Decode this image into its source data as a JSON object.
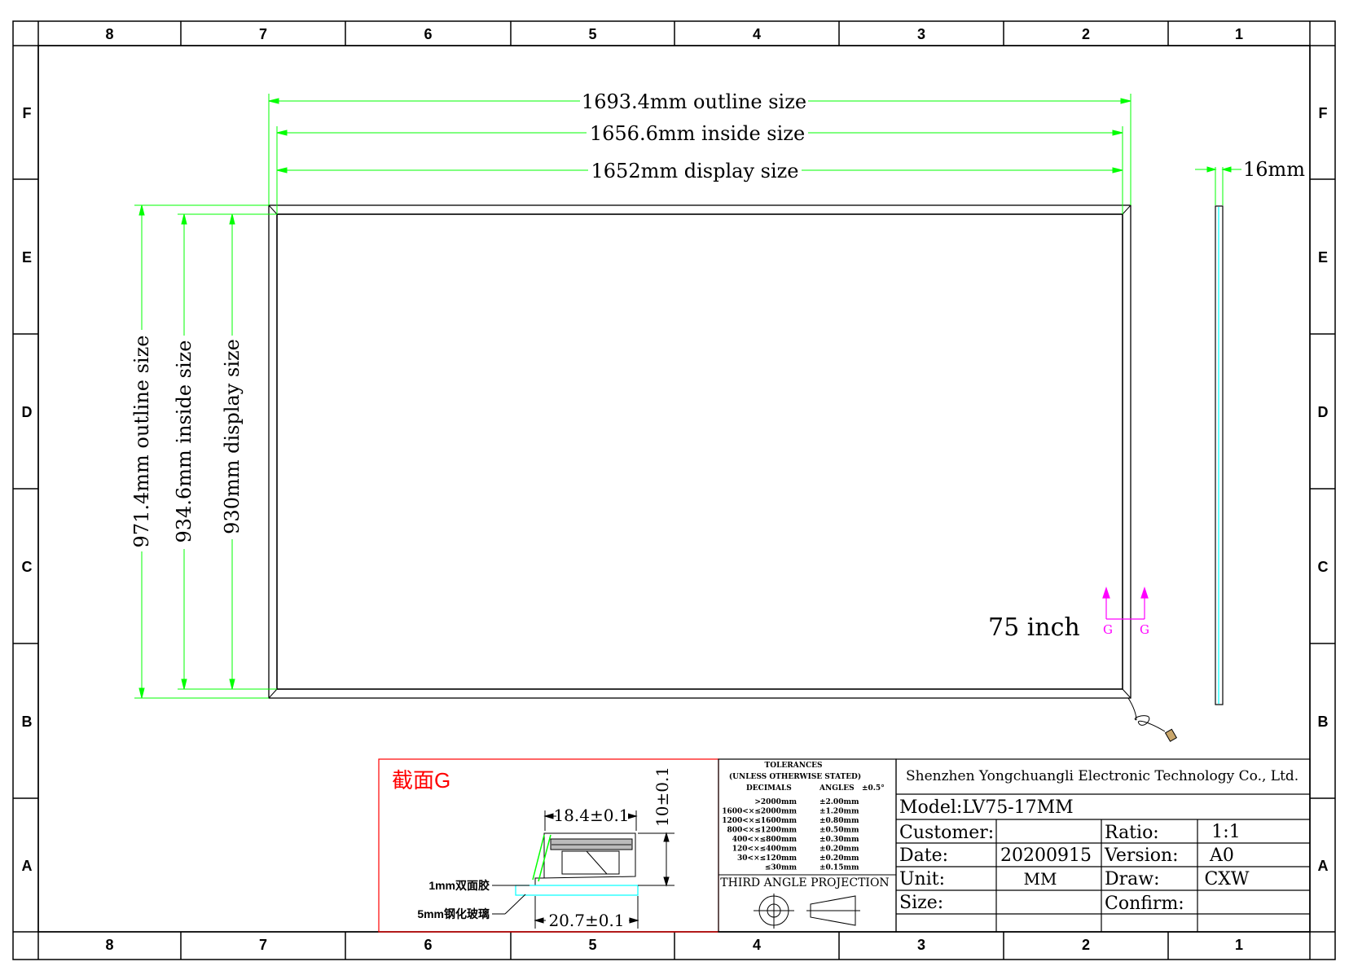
{
  "frame": {
    "columns": [
      "8",
      "7",
      "6",
      "5",
      "4",
      "3",
      "2",
      "1"
    ],
    "rows": [
      "F",
      "E",
      "D",
      "C",
      "B",
      "A"
    ]
  },
  "dimensions": {
    "outline_width": "1693.4mm outline size",
    "inside_width": "1656.6mm inside size",
    "display_width": "1652mm display size",
    "outline_height": "971.4mm outline size",
    "inside_height": "934.6mm inside size",
    "display_height": "930mm display size",
    "thickness": "16mm"
  },
  "panel": {
    "size_label": "75 inch",
    "section_marker_left": "G",
    "section_marker_right": "G"
  },
  "section": {
    "title": "截面G",
    "dim_width_top": "18.4±0.1",
    "dim_height": "10±0.1",
    "dim_width_bottom": "20.7±0.1",
    "label_tape": "1mm双面胶",
    "label_glass": "5mm钢化玻璃"
  },
  "tolerances": {
    "title": "TOLERANCES",
    "subtitle": "(UNLESS OTHERWISE STATED)",
    "col_decimals": "DECIMALS",
    "col_angles": "ANGLES",
    "angle_value": "±0.5°",
    "rows": [
      {
        "range": ">2000mm",
        "tol": "±2.00mm"
      },
      {
        "range": "1600<×≤2000mm",
        "tol": "±1.20mm"
      },
      {
        "range": "1200<×≤1600mm",
        "tol": "±0.80mm"
      },
      {
        "range": "800<×≤1200mm",
        "tol": "±0.50mm"
      },
      {
        "range": "400<×≤800mm",
        "tol": "±0.30mm"
      },
      {
        "range": "120<×≤400mm",
        "tol": "±0.20mm"
      },
      {
        "range": "30<×≤120mm",
        "tol": "±0.20mm"
      },
      {
        "range": "≤30mm",
        "tol": "±0.15mm"
      }
    ],
    "projection": "THIRD ANGLE PROJECTION"
  },
  "title_block": {
    "company": "Shenzhen Yongchuangli Electronic Technology Co., Ltd.",
    "model": "Model:LV75-17MM",
    "customer_label": "Customer:",
    "customer_value": "",
    "date_label": "Date:",
    "date_value": "20200915",
    "unit_label": "Unit:",
    "unit_value": "MM",
    "size_label": "Size:",
    "size_value": "",
    "ratio_label": "Ratio:",
    "ratio_value": "1:1",
    "version_label": "Version:",
    "version_value": "A0",
    "draw_label": "Draw:",
    "draw_value": "CXW",
    "confirm_label": "Confirm:",
    "confirm_value": ""
  },
  "colors": {
    "dimension": "#00ff00",
    "section_marker": "#ff00ff",
    "section_title": "#ff0000",
    "section_border": "#ff0000",
    "glass": "#00ffff",
    "line": "#000000"
  }
}
